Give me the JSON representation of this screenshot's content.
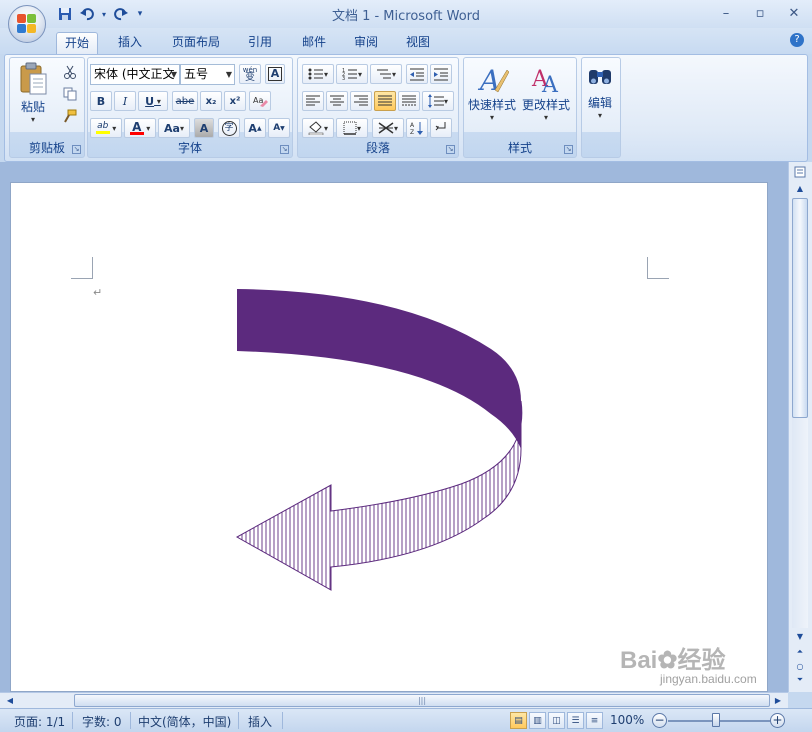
{
  "window": {
    "title": "文档 1 - Microsoft Word"
  },
  "tabs": [
    {
      "label": "开始",
      "active": true
    },
    {
      "label": "插入"
    },
    {
      "label": "页面布局"
    },
    {
      "label": "引用"
    },
    {
      "label": "邮件"
    },
    {
      "label": "审阅"
    },
    {
      "label": "视图"
    }
  ],
  "ribbon": {
    "clipboard": {
      "label": "剪贴板",
      "paste": "粘贴"
    },
    "font": {
      "label": "字体",
      "font_name": "宋体 (中文正文",
      "font_size": "五号",
      "wen": "wén",
      "wen_char": "变",
      "bold": "B",
      "italic": "I",
      "underline": "U",
      "strike": "abe",
      "sub": "x₂",
      "sup": "x²",
      "highlight": "ab",
      "color": "A",
      "case": "Aa",
      "grow": "A",
      "shrink": "A",
      "shade": "A",
      "enclose": "字"
    },
    "paragraph": {
      "label": "段落"
    },
    "styles": {
      "label": "样式",
      "quick": "快速样式",
      "change": "更改样式"
    },
    "editing": {
      "label": "编辑"
    }
  },
  "doc": {
    "paragraph_mark": "↵"
  },
  "status": {
    "page": "页面: 1/1",
    "words": "字数: 0",
    "language": "中文(简体，中国)",
    "mode": "插入",
    "zoom": "100%"
  },
  "watermark": {
    "main": "Bai%经验",
    "sub": "jingyan.baidu.com"
  },
  "colors": {
    "arrow": "#5c2a7e",
    "highlight_bar": "#ffff00",
    "font_color_bar": "#ff0000"
  }
}
